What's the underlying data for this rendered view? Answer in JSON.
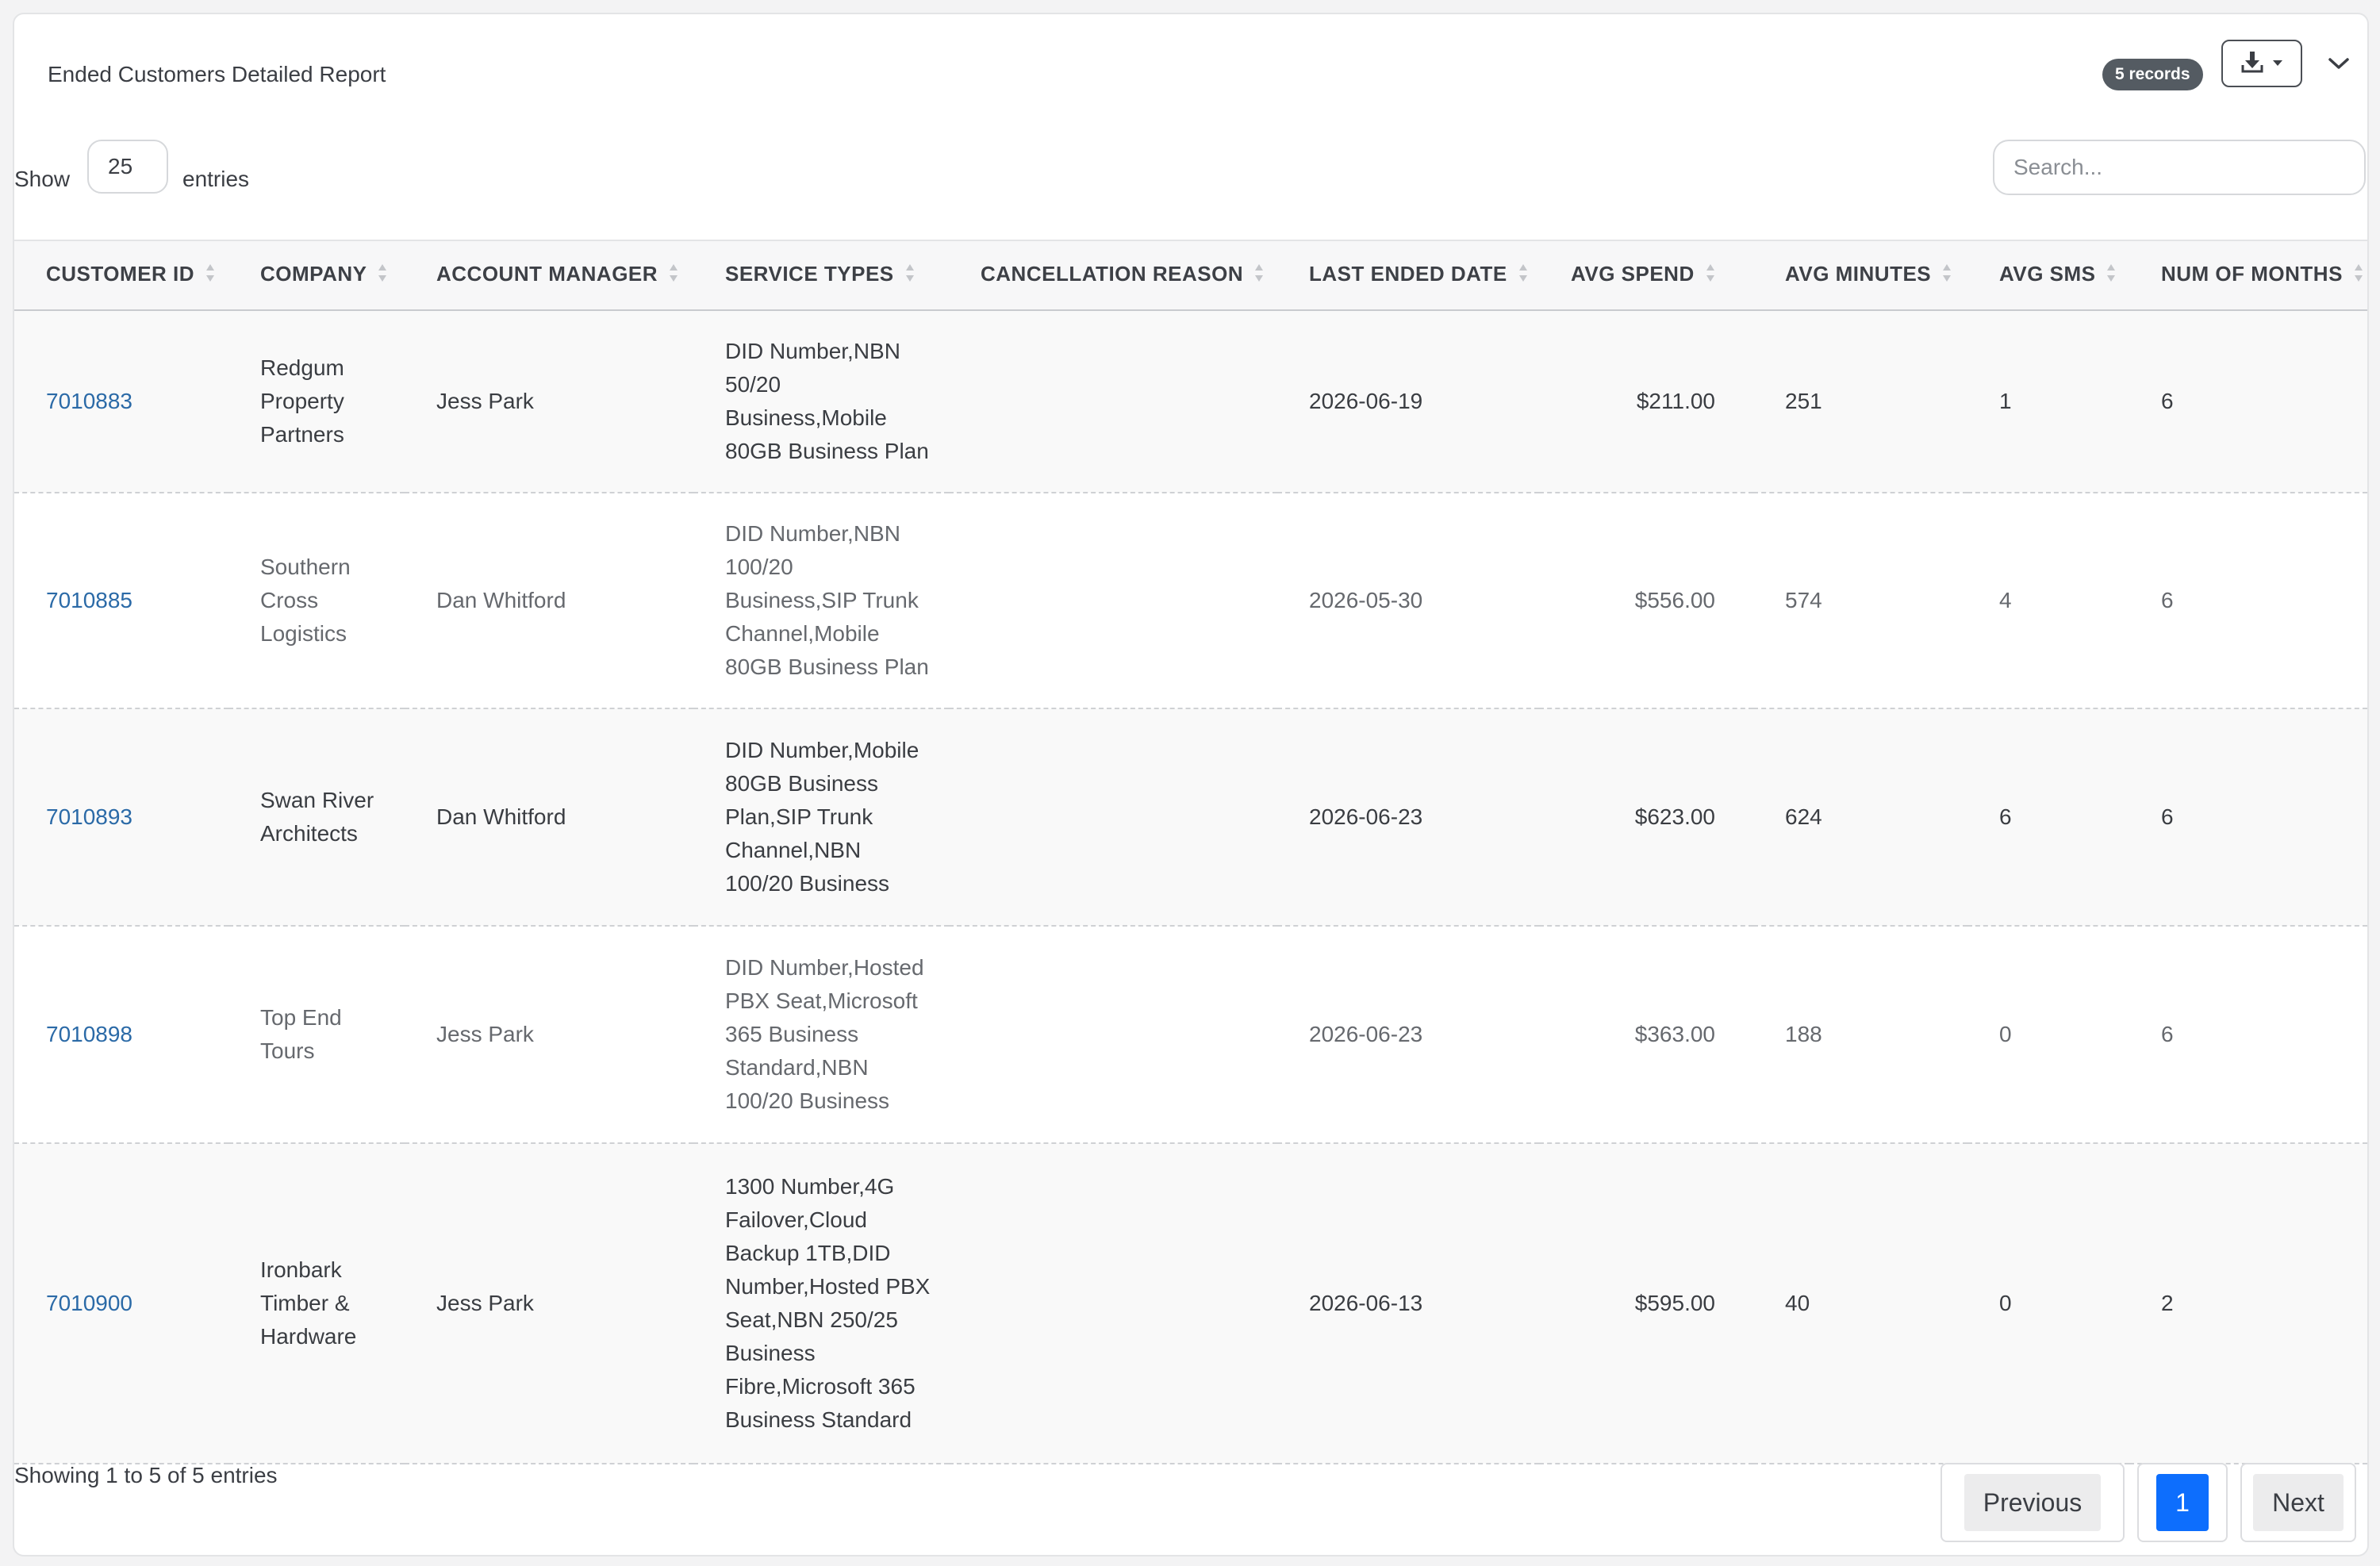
{
  "report": {
    "title": "Ended Customers Detailed Report",
    "records_badge": "5 records"
  },
  "toolbar": {
    "download_icon": "download-icon",
    "caret_icon": "caret-down-icon",
    "collapse_icon": "chevron-down-icon"
  },
  "length": {
    "show_label": "Show",
    "value": "25",
    "entries_label": "entries"
  },
  "search": {
    "placeholder": "Search..."
  },
  "table": {
    "columns": [
      "CUSTOMER ID",
      "COMPANY",
      "ACCOUNT MANAGER",
      "SERVICE TYPES",
      "CANCELLATION REASON",
      "LAST ENDED DATE",
      "AVG SPEND",
      "AVG MINUTES",
      "AVG SMS",
      "NUM OF MONTHS"
    ],
    "rows": [
      {
        "customer_id": "7010883",
        "company": [
          "Redgum",
          "Property",
          "Partners"
        ],
        "account_manager": "Jess Park",
        "service_types": [
          "DID Number,NBN",
          "50/20",
          "Business,Mobile",
          "80GB Business Plan"
        ],
        "cancellation_reason": "",
        "last_ended_date": "2026-06-19",
        "avg_spend": "$211.00",
        "avg_minutes": "251",
        "avg_sms": "1",
        "num_months": "6"
      },
      {
        "customer_id": "7010885",
        "company": [
          "Southern",
          "Cross",
          "Logistics"
        ],
        "account_manager": "Dan Whitford",
        "service_types": [
          "DID Number,NBN",
          "100/20",
          "Business,SIP Trunk",
          "Channel,Mobile",
          "80GB Business Plan"
        ],
        "cancellation_reason": "",
        "last_ended_date": "2026-05-30",
        "avg_spend": "$556.00",
        "avg_minutes": "574",
        "avg_sms": "4",
        "num_months": "6"
      },
      {
        "customer_id": "7010893",
        "company": [
          "Swan River",
          "Architects"
        ],
        "account_manager": "Dan Whitford",
        "service_types": [
          "DID Number,Mobile",
          "80GB Business",
          "Plan,SIP Trunk",
          "Channel,NBN",
          "100/20 Business"
        ],
        "cancellation_reason": "",
        "last_ended_date": "2026-06-23",
        "avg_spend": "$623.00",
        "avg_minutes": "624",
        "avg_sms": "6",
        "num_months": "6"
      },
      {
        "customer_id": "7010898",
        "company": [
          "Top End",
          "Tours"
        ],
        "account_manager": "Jess Park",
        "service_types": [
          "DID Number,Hosted",
          "PBX Seat,Microsoft",
          "365 Business",
          "Standard,NBN",
          "100/20 Business"
        ],
        "cancellation_reason": "",
        "last_ended_date": "2026-06-23",
        "avg_spend": "$363.00",
        "avg_minutes": "188",
        "avg_sms": "0",
        "num_months": "6"
      },
      {
        "customer_id": "7010900",
        "company": [
          "Ironbark",
          "Timber &",
          "Hardware"
        ],
        "account_manager": "Jess Park",
        "service_types": [
          "1300 Number,4G",
          "Failover,Cloud",
          "Backup 1TB,DID",
          "Number,Hosted PBX",
          "Seat,NBN 250/25",
          "Business",
          "Fibre,Microsoft 365",
          "Business Standard"
        ],
        "cancellation_reason": "",
        "last_ended_date": "2026-06-13",
        "avg_spend": "$595.00",
        "avg_minutes": "40",
        "avg_sms": "0",
        "num_months": "2"
      }
    ]
  },
  "footer": {
    "info": "Showing 1 to 5 of 5 entries",
    "previous_label": "Previous",
    "current_page": "1",
    "next_label": "Next"
  },
  "colors": {
    "link": "#2b6aa7",
    "badge": "#545b62",
    "active_page": "#0d6efd"
  }
}
